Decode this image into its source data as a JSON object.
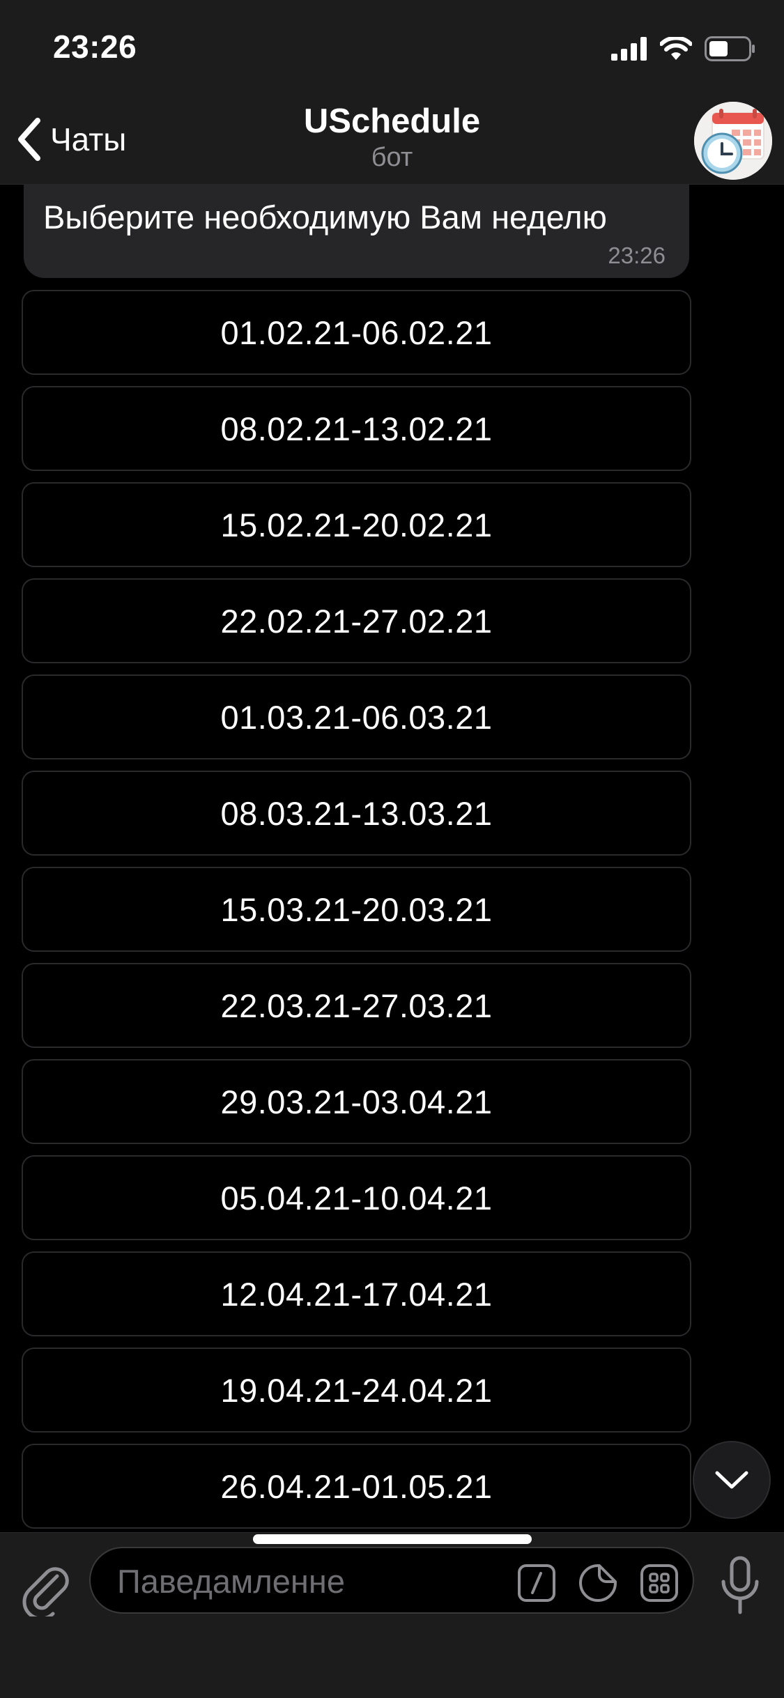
{
  "status": {
    "time": "23:26"
  },
  "header": {
    "back_label": "Чаты",
    "title": "USchedule",
    "subtitle": "бот"
  },
  "message": {
    "text": "Выберите необходимую Вам неделю",
    "time": "23:26"
  },
  "keyboard": [
    "01.02.21-06.02.21",
    "08.02.21-13.02.21",
    "15.02.21-20.02.21",
    "22.02.21-27.02.21",
    "01.03.21-06.03.21",
    "08.03.21-13.03.21",
    "15.03.21-20.03.21",
    "22.03.21-27.03.21",
    "29.03.21-03.04.21",
    "05.04.21-10.04.21",
    "12.04.21-17.04.21",
    "19.04.21-24.04.21",
    "26.04.21-01.05.21"
  ],
  "input": {
    "placeholder": "Паведамленне"
  },
  "colors": {
    "background": "#000000",
    "bar": "#1c1c1d",
    "bubble": "#262628",
    "button_border": "#2a2a2d",
    "muted": "#8e8e93"
  },
  "icons": {
    "back": "chevron-left-icon",
    "signal": "cellular-signal-icon",
    "wifi": "wifi-icon",
    "battery": "battery-icon",
    "avatar": "calendar-clock-avatar",
    "scroll": "chevron-down-icon",
    "attach": "paperclip-icon",
    "commands": "slash-command-icon",
    "sticker": "sticker-icon",
    "bot_keyboard": "keyboard-grid-icon",
    "mic": "microphone-icon"
  }
}
